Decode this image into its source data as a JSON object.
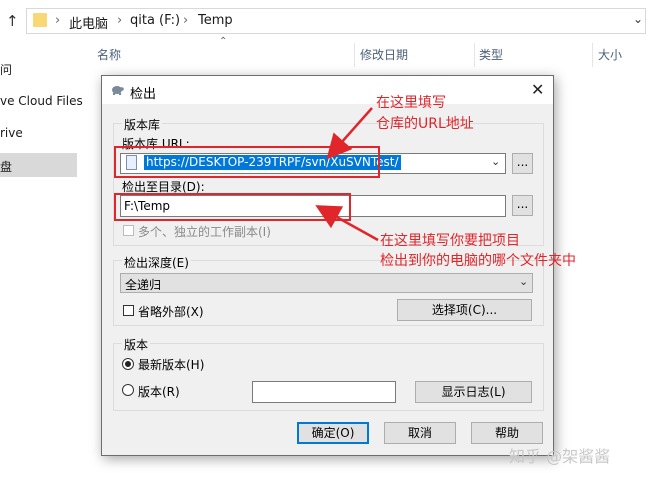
{
  "explorer": {
    "breadcrumb": [
      "此电脑",
      "qita (F:)",
      "Temp"
    ],
    "columns": [
      "名称",
      "修改日期",
      "类型",
      "大小"
    ],
    "nav_items": [
      "问",
      "ve Cloud Files",
      "rive",
      "盘"
    ]
  },
  "dialog": {
    "title": "检出",
    "repository_group": "版本库",
    "repo_url_label": "版本库 URL:",
    "repo_url_value": "https://DESKTOP-239TRPF/svn/XuSVNTest/",
    "browse_label": "...",
    "checkout_dir_label": "检出至目录(D):",
    "checkout_dir_value": "F:\\Temp",
    "multi_workcopy_label": "多个、独立的工作副本(I)",
    "depth_label": "检出深度(E)",
    "depth_value": "全递归",
    "omit_externals_label": "省略外部(X)",
    "options_button": "选择项(C)...",
    "revision_group": "版本",
    "head_revision_label": "最新版本(H)",
    "revision_label": "版本(R)",
    "show_log_button": "显示日志(L)",
    "ok_button": "确定(O)",
    "cancel_button": "取消",
    "help_button": "帮助"
  },
  "annotations": {
    "top": [
      "在这里填写",
      "仓库的URL地址"
    ],
    "bottom": [
      "在这里填写你要把项目",
      "检出到你的电脑的哪个文件夹中"
    ]
  },
  "watermark": "知乎 @架酱酱",
  "colors": {
    "annotation_red": "#e0262b",
    "selection_blue": "#0078d7",
    "folder_yellow": "#f8d775"
  }
}
